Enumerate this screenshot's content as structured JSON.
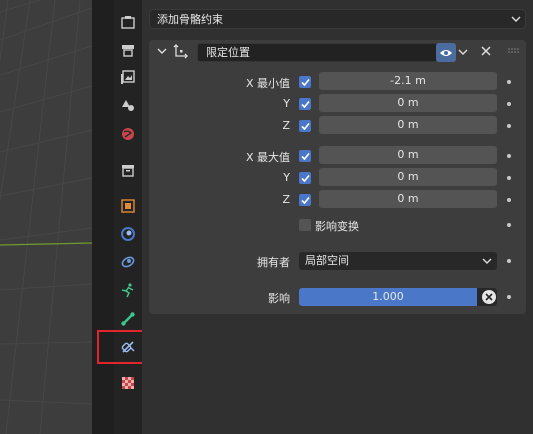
{
  "add_constraint": {
    "label": "添加骨骼约束"
  },
  "constraint": {
    "name": "限定位置",
    "min": {
      "label": "X 最小值",
      "rows": [
        {
          "axis": "X",
          "enabled": true,
          "value": "-2.1 m"
        },
        {
          "axis": "Y",
          "enabled": true,
          "value": "0 m"
        },
        {
          "axis": "Z",
          "enabled": true,
          "value": "0 m"
        }
      ]
    },
    "max": {
      "label": "X 最大值",
      "rows": [
        {
          "axis": "X",
          "enabled": true,
          "value": "0 m"
        },
        {
          "axis": "Y",
          "enabled": true,
          "value": "0 m"
        },
        {
          "axis": "Z",
          "enabled": true,
          "value": "0 m"
        }
      ]
    },
    "affect_transform": {
      "label": "影响变换",
      "checked": false
    },
    "owner": {
      "label": "拥有者",
      "value": "局部空间"
    },
    "influence": {
      "label": "影响",
      "value": "1.000",
      "fraction": 1.0
    }
  },
  "tabs": [
    {
      "icon": "tool-icon"
    },
    {
      "icon": "render-icon"
    },
    {
      "icon": "output-icon"
    },
    {
      "icon": "view-layer-icon"
    },
    {
      "icon": "scene-icon"
    },
    {
      "icon": "world-icon"
    },
    {
      "icon": "collection-icon"
    },
    {
      "icon": "object-icon"
    },
    {
      "icon": "modifier-icon"
    },
    {
      "icon": "particles-icon"
    },
    {
      "icon": "physics-icon"
    },
    {
      "icon": "object-constraint-icon"
    },
    {
      "icon": "bone-icon"
    },
    {
      "icon": "bone-constraint-icon",
      "active": true
    },
    {
      "icon": "texture-icon"
    }
  ],
  "colors": {
    "accent": "#4a77c8",
    "eye_active": "#4a6c9e",
    "highlight": "#e0262b",
    "panel": "#3d3d3d"
  }
}
